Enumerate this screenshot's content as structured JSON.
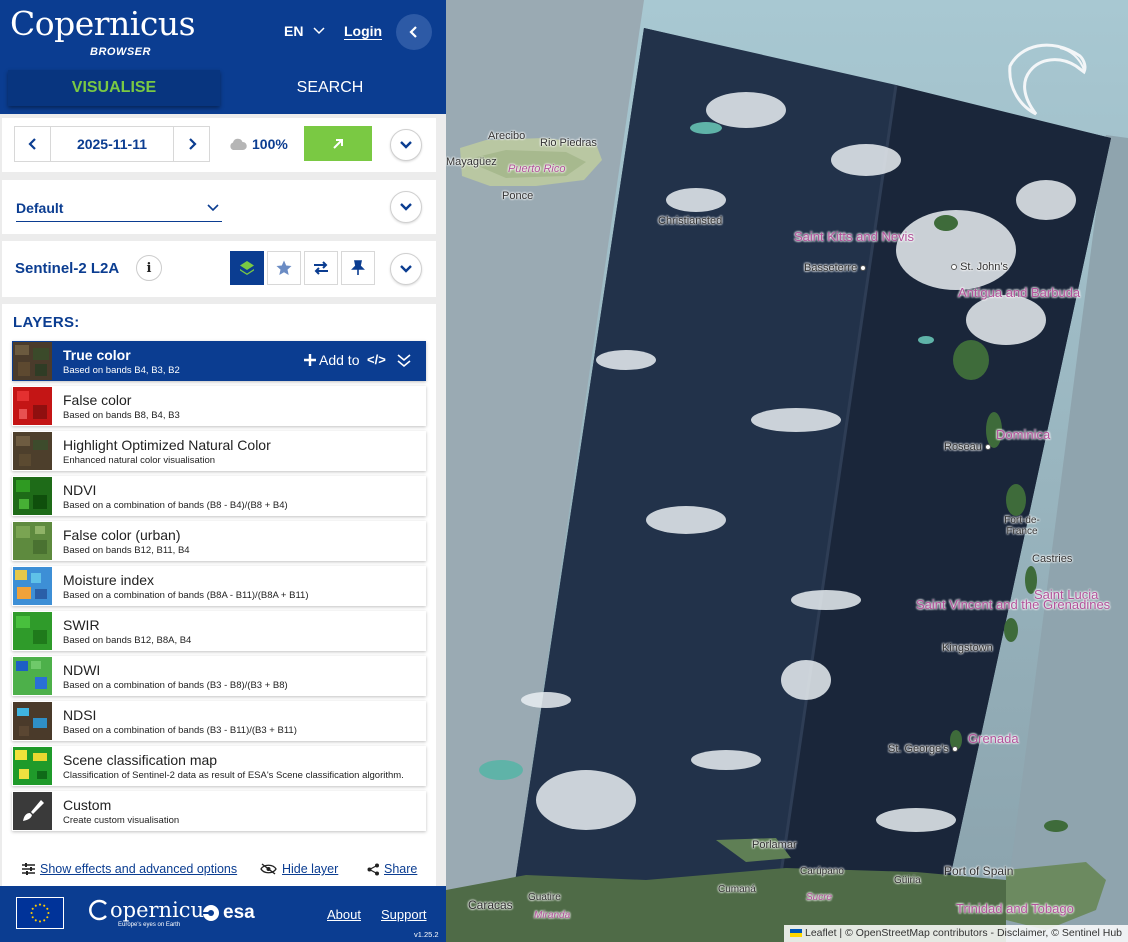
{
  "header": {
    "logo_text": "Copernicus",
    "logo_sub": "BROWSER",
    "language": "EN",
    "login": "Login"
  },
  "tabs": {
    "visualise": "VISUALISE",
    "search": "SEARCH"
  },
  "date_panel": {
    "date": "2025-11-11",
    "cloud_coverage": "100%"
  },
  "theme": {
    "selected": "Default"
  },
  "dataset": {
    "name": "Sentinel-2 L2A",
    "info": "i"
  },
  "layers": {
    "title": "LAYERS:",
    "add_to": "Add to",
    "code": "</>",
    "items": [
      {
        "name": "True color",
        "desc": "Based on bands B4, B3, B2"
      },
      {
        "name": "False color",
        "desc": "Based on bands B8, B4, B3"
      },
      {
        "name": "Highlight Optimized Natural Color",
        "desc": "Enhanced natural color visualisation"
      },
      {
        "name": "NDVI",
        "desc": "Based on a combination of bands (B8 - B4)/(B8 + B4)"
      },
      {
        "name": "False color (urban)",
        "desc": "Based on bands B12, B11, B4"
      },
      {
        "name": "Moisture index",
        "desc": "Based on a combination of bands (B8A - B11)/(B8A + B11)"
      },
      {
        "name": "SWIR",
        "desc": "Based on bands B12, B8A, B4"
      },
      {
        "name": "NDWI",
        "desc": "Based on a combination of bands (B3 - B8)/(B3 + B8)"
      },
      {
        "name": "NDSI",
        "desc": "Based on a combination of bands (B3 - B11)/(B3 + B11)"
      },
      {
        "name": "Scene classification map",
        "desc": "Classification of Sentinel-2 data as result of ESA's Scene classification algorithm."
      },
      {
        "name": "Custom",
        "desc": "Create custom visualisation"
      }
    ]
  },
  "footer_links": {
    "effects": "Show effects and advanced options",
    "hide": "Hide layer",
    "share": "Share"
  },
  "bottom": {
    "copernicus": "opernicus",
    "copernicus_sub": "Europe's eyes on Earth",
    "esa": "esa",
    "about": "About",
    "support": "Support",
    "version": "v1.25.2"
  },
  "map": {
    "labels": {
      "arecibo": "Arecibo",
      "rio_piedras": "Rio Piedras",
      "mayaguez": "Mayagüez",
      "puerto_rico": "Puerto Rico",
      "ponce": "Ponce",
      "christiansted": "Christiansted",
      "saint_kitts": "Saint Kitts and Nevis",
      "basseterre": "Basseterre",
      "st_johns": "St. John's",
      "antigua": "Antigua and Barbuda",
      "roseau": "Roseau",
      "dominica": "Dominica",
      "fort_de_france": "Fort-de-France",
      "castries": "Castries",
      "saint_lucia": "Saint Lucia",
      "saint_vincent": "Saint Vincent and the Grenadines",
      "kingstown": "Kingstown",
      "st_georges": "St. George's",
      "grenada": "Grenada",
      "porlamar": "Porlamar",
      "carupano": "Carúpano",
      "cumana": "Cumaná",
      "guiria": "Güiria",
      "port_of_spain": "Port of Spain",
      "trinidad": "Trinidad and Tobago",
      "caracas": "Caracas",
      "guatire": "Guatire",
      "miranda": "Miranda",
      "sucre": "Sucre"
    },
    "attribution": "Leaflet | © OpenStreetMap contributors - Disclaimer, © Sentinel Hub"
  }
}
